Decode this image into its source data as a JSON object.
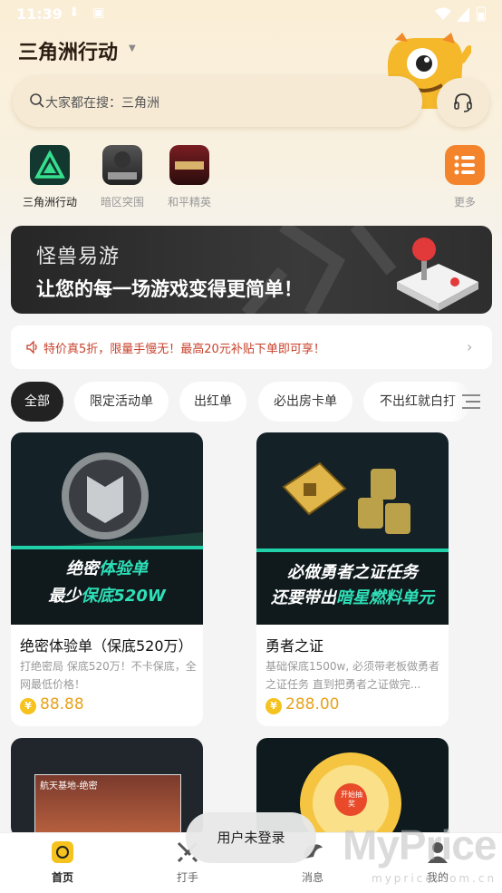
{
  "status_bar": {
    "time": "11:39"
  },
  "header": {
    "title": "三角洲行动"
  },
  "search": {
    "placeholder": "大家都在搜：三角洲"
  },
  "games": [
    {
      "label": "三角洲行动"
    },
    {
      "label": "暗区突围"
    },
    {
      "label": "和平精英"
    },
    {
      "label": "更多"
    }
  ],
  "banner": {
    "brand": "怪兽易游",
    "slogan": "让您的每一场游戏变得更简单！"
  },
  "notice": {
    "text": "特价真5折，限量手慢无！最高20元补贴下单即可享！"
  },
  "filter_tabs": [
    "全部",
    "限定活动单",
    "出红单",
    "必出房卡单",
    "不出红就白打"
  ],
  "products": [
    {
      "caption_line1": "绝密",
      "caption_accent1": "体验单",
      "caption_line2": "最少",
      "caption_accent2": "保底520W",
      "title": "绝密体验单（保底520万）",
      "desc": "打绝密局 保底520万！不卡保底，全网最低价格！",
      "price": "88.88"
    },
    {
      "caption_line1": "必做勇者之证任务",
      "caption_line2": "还要带出",
      "caption_accent2": "暗星燃料单元",
      "title": "勇者之证",
      "desc": "基础保底1500w, 必须带老板做勇者之证任务 直到把勇者之证做完...",
      "price": "288.00"
    },
    {
      "image_text": "航天基地-绝密"
    },
    {
      "image_text": "开始抽奖"
    }
  ],
  "coin_symbol": "¥",
  "tabbar": [
    {
      "label": "首页"
    },
    {
      "label": "打手"
    },
    {
      "label": "消息"
    },
    {
      "label": "我的"
    }
  ],
  "toast": "用户未登录",
  "watermark": {
    "main": "MyPrice",
    "sub": "myprice.com.cn"
  },
  "colors": {
    "accent": "#f6c21d",
    "price": "#e7a21b",
    "notice": "#c8412b",
    "caption_accent": "#2ee0b8"
  }
}
